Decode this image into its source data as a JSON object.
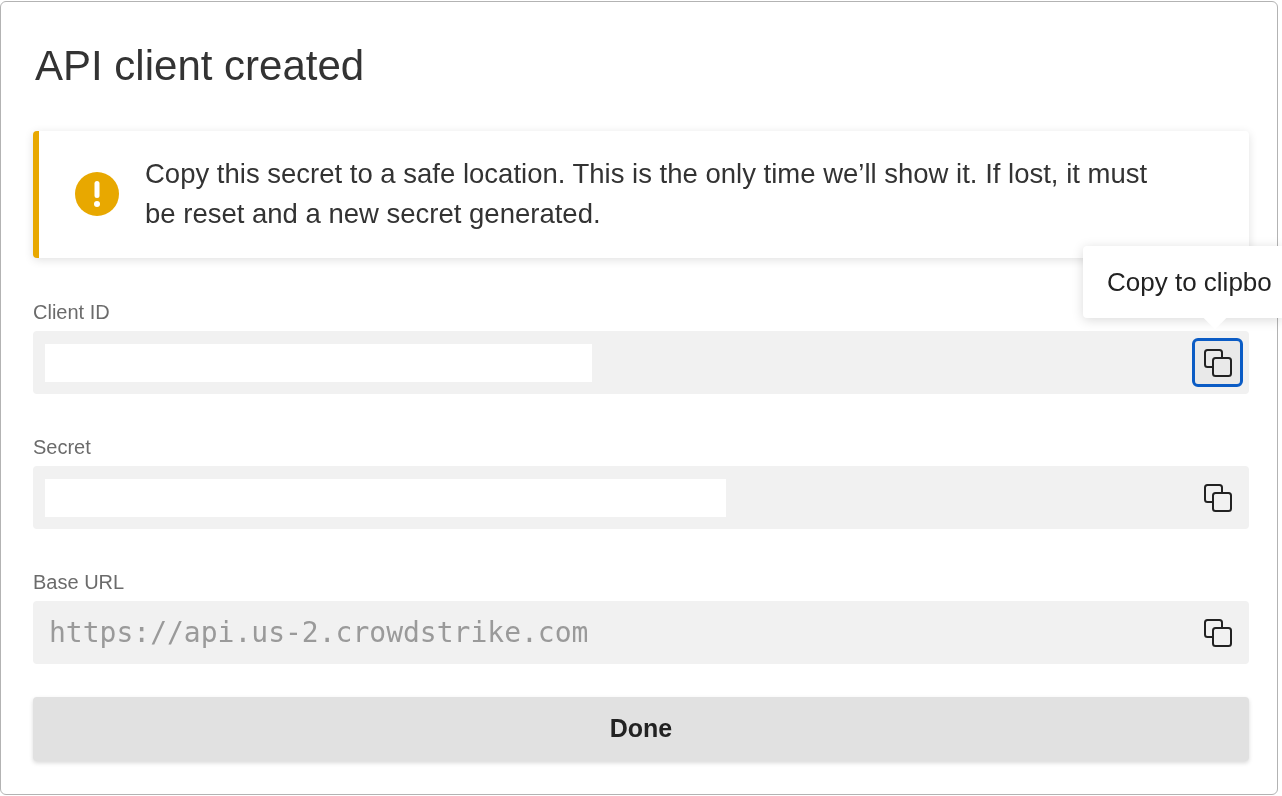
{
  "dialog": {
    "title": "API client created"
  },
  "alert": {
    "kind": "warning",
    "message": "Copy this secret to a safe location. This is the only time we’ll show it. If lost, it must be reset and a new secret generated."
  },
  "fields": [
    {
      "label": "Client ID",
      "redacted": true,
      "focused": true
    },
    {
      "label": "Secret",
      "redacted": true,
      "focused": false
    },
    {
      "label": "Base URL",
      "value": "https://api.us-2.crowdstrike.com",
      "redacted": false,
      "focused": false
    }
  ],
  "tooltip": {
    "text": "Copy to clipbo"
  },
  "buttons": [
    {
      "label": "Done"
    }
  ]
}
